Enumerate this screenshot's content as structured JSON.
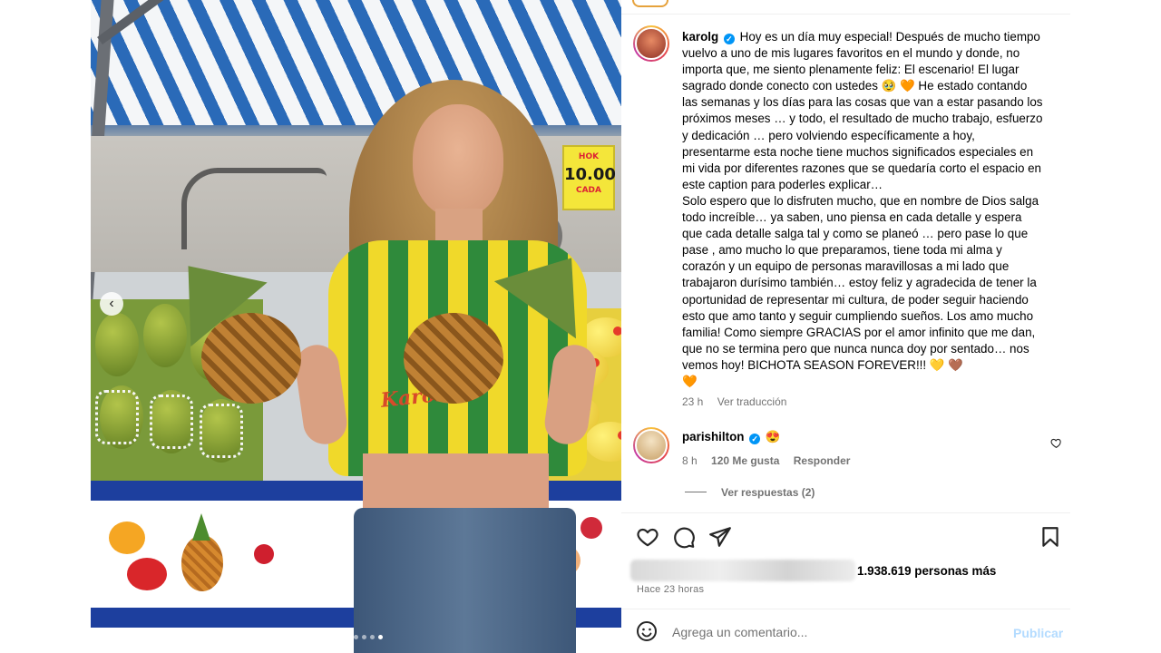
{
  "post": {
    "author": {
      "username": "karolg",
      "verified": true
    },
    "caption": "Hoy es un día muy especial! Después de mucho tiempo vuelvo a uno de mis lugares favoritos en el mundo y donde, no importa que, me siento plenamente feliz: El escenario! El lugar sagrado donde conecto con ustedes 🥹 🧡 He estado contando las semanas y los días para las cosas que van a estar pasando los próximos meses … y todo, el resultado de mucho trabajo, esfuerzo y dedicación … pero volviendo específicamente a hoy, presentarme esta noche tiene muchos significados especiales en mi vida por diferentes razones que se quedaría corto el espacio en este caption para poderles explicar…\nSolo espero que lo disfruten mucho, que en nombre de Dios salga todo increíble… ya saben, uno piensa en cada detalle y espera que cada detalle salga tal y como se planeó … pero pase lo que pase , amo mucho lo que preparamos, tiene toda mi alma y corazón y un equipo de personas maravillosas a mi lado que trabajaron durísimo también… estoy feliz y agradecida de tener la oportunidad de representar mi cultura, de poder seguir haciendo esto que amo tanto y seguir cumpliendo sueños. Los amo mucho familia! Como siempre GRACIAS por el amor infinito que me dan, que no se termina pero que nunca nunca doy por sentado… nos vemos hoy! BICHOTA SEASON FOREVER!!! 💛 🤎\n🧡",
    "time": "23 h",
    "translate_label": "Ver traducción",
    "photo_sign": {
      "line1": "HOK",
      "line2": "10.00",
      "line3": "CADA"
    },
    "shirt_text": "Karol G",
    "carousel": {
      "total": 7,
      "active_index": 6,
      "prev_glyph": "‹"
    }
  },
  "comments": [
    {
      "username": "parishilton",
      "verified": true,
      "text": "😍",
      "time": "8 h",
      "likes": "120 Me gusta",
      "reply_label": "Responder",
      "view_replies_label": "Ver respuestas (2)"
    }
  ],
  "actions": {
    "like_icon": "heart-icon",
    "comment_icon": "comment-icon",
    "share_icon": "share-icon",
    "save_icon": "bookmark-icon"
  },
  "likes": {
    "count_text": "1.938.619 personas más"
  },
  "timestamp": "Hace 23 horas",
  "comment_box": {
    "placeholder": "Agrega un comentario...",
    "publish_label": "Publicar"
  },
  "colors": {
    "verified": "#0095f6",
    "publish_disabled": "#b3dbff",
    "muted": "#737373"
  }
}
